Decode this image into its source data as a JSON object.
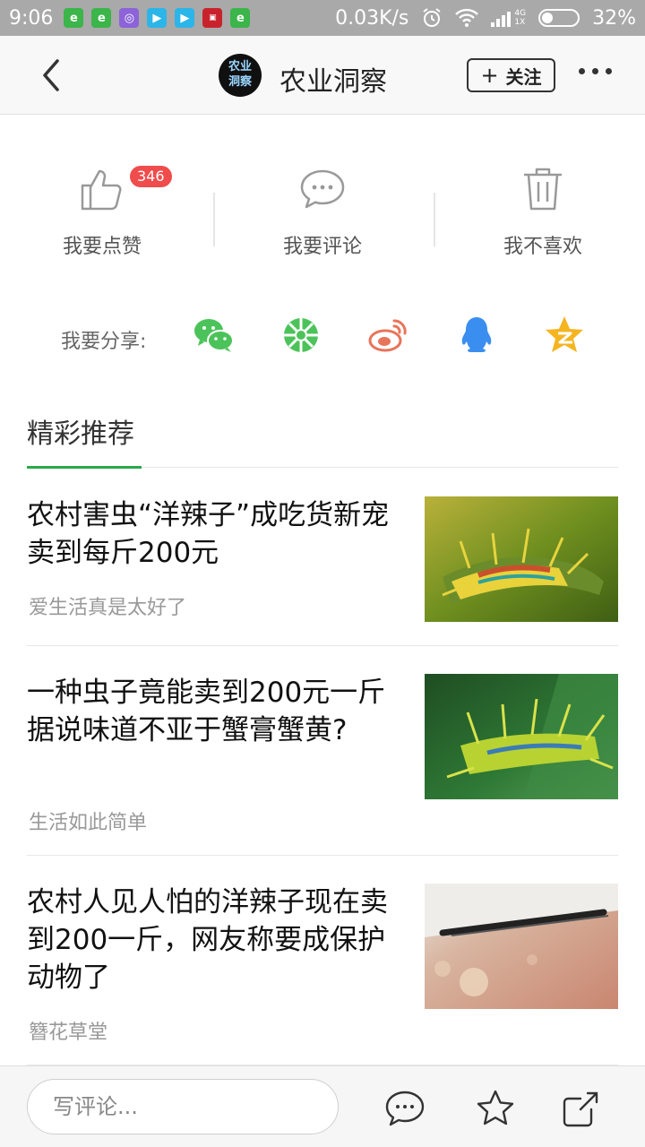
{
  "status_bar": {
    "time": "9:06",
    "network_speed": "0.03K/s",
    "network_type": "4G",
    "sim_label": "1X",
    "battery_percent": "32%",
    "battery_level": 0.32
  },
  "header": {
    "logo_line1": "农业",
    "logo_line2": "洞察",
    "title": "农业洞察",
    "follow_label": "关注"
  },
  "actions": {
    "like_label": "我要点赞",
    "like_count": "346",
    "comment_label": "我要评论",
    "dislike_label": "我不喜欢"
  },
  "share": {
    "label": "我要分享:",
    "targets": [
      "wechat-icon",
      "moments-icon",
      "weibo-icon",
      "qq-icon",
      "qzone-icon"
    ]
  },
  "section": {
    "title": "精彩推荐"
  },
  "articles": [
    {
      "title": "农村害虫“洋辣子”成吃货新宠 卖到每斤200元",
      "source": "爱生活真是太好了"
    },
    {
      "title": "一种虫子竟能卖到200元一斤 据说味道不亚于蟹膏蟹黄?",
      "source": "生活如此简单"
    },
    {
      "title": "农村人见人怕的洋辣子现在卖到200一斤，网友称要成保护动物了",
      "source": "簪花草堂"
    }
  ],
  "bottom_bar": {
    "comment_placeholder": "写评论..."
  },
  "colors": {
    "accent_green": "#2aaa4a",
    "badge_red": "#f04c4c",
    "wechat_green": "#4cc35a",
    "weibo_red": "#e8745a",
    "qq_blue": "#3a8ef0",
    "qzone_yellow": "#f5b521"
  }
}
